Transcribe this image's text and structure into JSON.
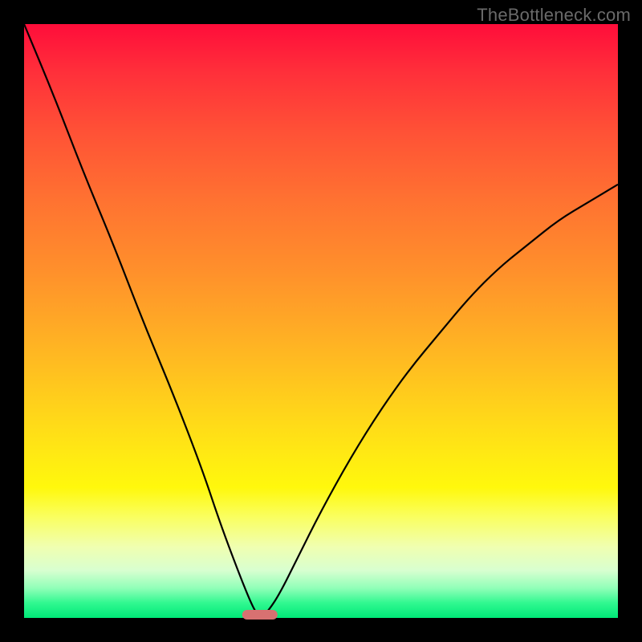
{
  "watermark": "TheBottleneck.com",
  "colors": {
    "frame": "#000000",
    "curve": "#000000",
    "marker": "#d87171",
    "gradient_top": "#ff0d3a",
    "gradient_bottom": "#00e878"
  },
  "chart_data": {
    "type": "line",
    "title": "",
    "xlabel": "",
    "ylabel": "",
    "xlim": [
      0,
      100
    ],
    "ylim": [
      0,
      100
    ],
    "grid": false,
    "legend": false,
    "x": [
      0,
      5,
      10,
      15,
      20,
      25,
      30,
      33,
      36,
      38,
      39,
      39.7,
      41,
      43,
      46,
      50,
      55,
      60,
      65,
      70,
      75,
      80,
      85,
      90,
      95,
      100
    ],
    "values": [
      100,
      88,
      75,
      63,
      50,
      38,
      25,
      16,
      8,
      3,
      1,
      0,
      1,
      4,
      10,
      18,
      27,
      35,
      42,
      48,
      54,
      59,
      63,
      67,
      70,
      73
    ],
    "minimum_x": 39.7,
    "marker": {
      "x": 39.7,
      "y": 0,
      "width_pct": 6,
      "color": "#d87171"
    },
    "note": "V-shaped bottleneck curve; y is bottleneck magnitude (0 = balanced), background gradient encodes severity (red high → green low). Values estimated from pixel positions."
  }
}
